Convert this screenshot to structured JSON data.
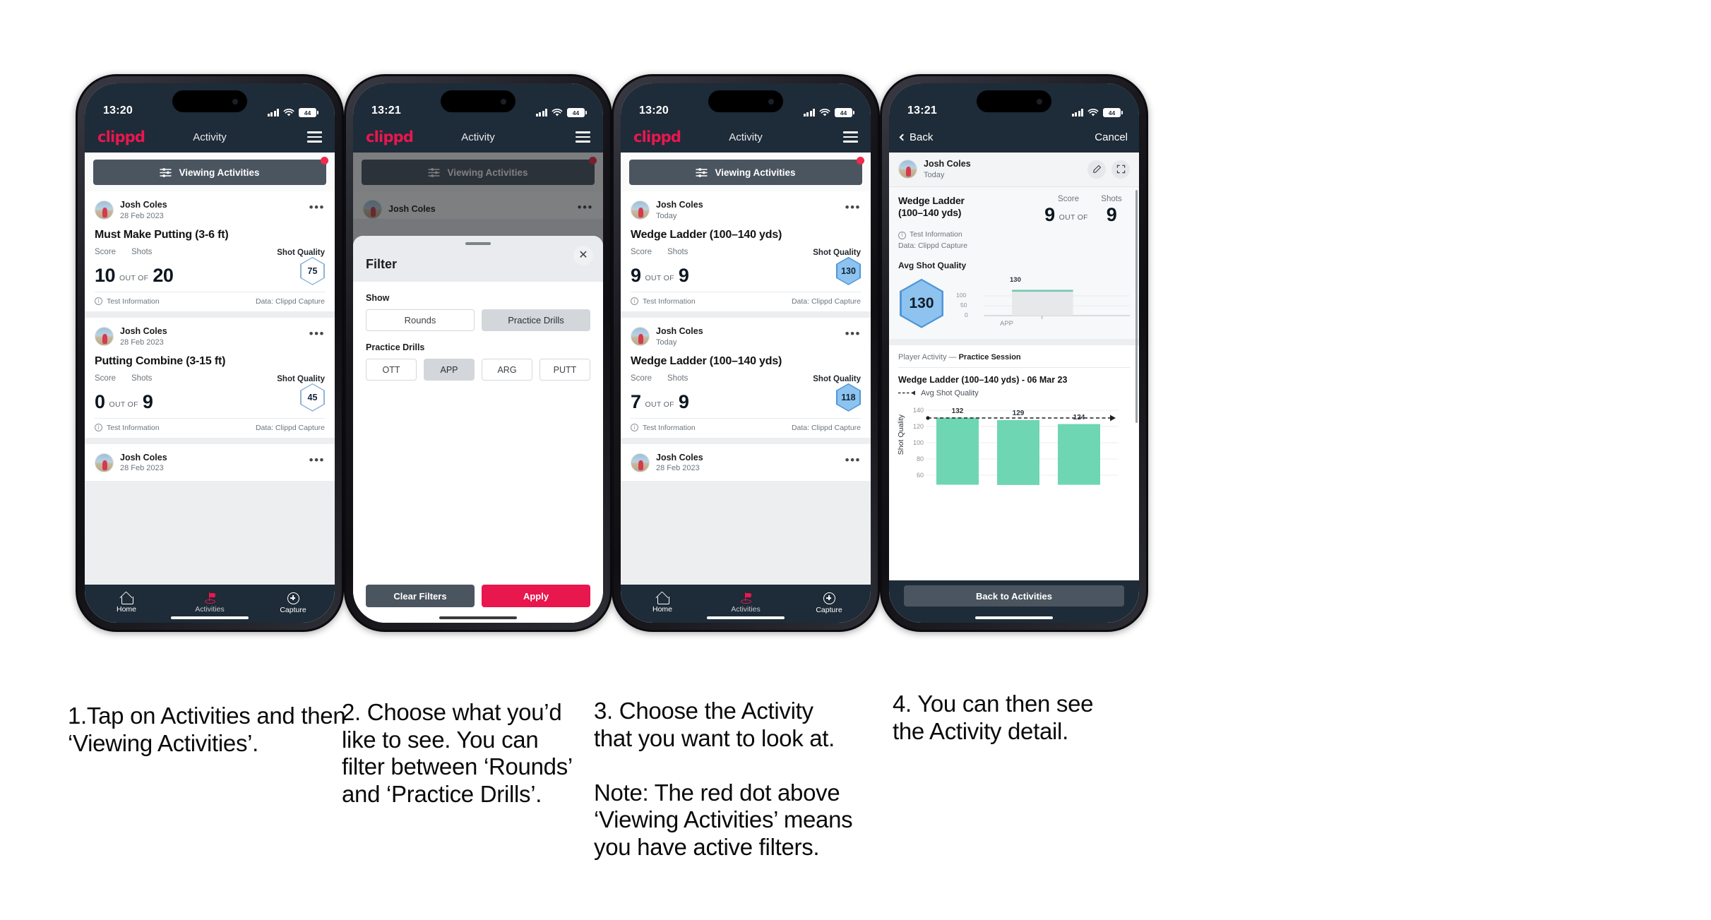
{
  "phones": [
    {
      "status": {
        "clock": "13:20",
        "battery": "44"
      },
      "appbar": {
        "brand": "clippd",
        "title": "Activity",
        "menu_icon": "hamburger-icon"
      },
      "filter_bar": {
        "label": "Viewing Activities",
        "icon": "sliders-icon",
        "has_badge": true
      },
      "cards": [
        {
          "user": "Josh Coles",
          "date": "28 Feb 2023",
          "title": "Must Make Putting (3-6 ft)",
          "score_label": "Score",
          "shots_label": "Shots",
          "quality_label": "Shot Quality",
          "score": "10",
          "outof": "OUT OF",
          "shots": "20",
          "quality": "75",
          "quality_style": "outline",
          "foot_left": "Test Information",
          "foot_right": "Data: Clippd Capture"
        },
        {
          "user": "Josh Coles",
          "date": "28 Feb 2023",
          "title": "Putting Combine (3-15 ft)",
          "score_label": "Score",
          "shots_label": "Shots",
          "quality_label": "Shot Quality",
          "score": "0",
          "outof": "OUT OF",
          "shots": "9",
          "quality": "45",
          "quality_style": "outline",
          "foot_left": "Test Information",
          "foot_right": "Data: Clippd Capture"
        },
        {
          "user": "Josh Coles",
          "date": "28 Feb 2023"
        }
      ],
      "tabs": [
        {
          "label": "Home",
          "icon": "home-icon",
          "active": false
        },
        {
          "label": "Activities",
          "icon": "golf-flag-icon",
          "active": true
        },
        {
          "label": "Capture",
          "icon": "plus-circle-icon",
          "active": false
        }
      ]
    },
    {
      "status": {
        "clock": "13:21",
        "battery": "44"
      },
      "appbar": {
        "brand": "clippd",
        "title": "Activity",
        "menu_icon": "hamburger-icon"
      },
      "filter_bar": {
        "label": "Viewing Activities",
        "icon": "sliders-icon",
        "has_badge": true
      },
      "behind_card_user": "Josh Coles",
      "sheet": {
        "title": "Filter",
        "close_icon": "close-icon",
        "show_label": "Show",
        "show_options": [
          {
            "label": "Rounds",
            "selected": false
          },
          {
            "label": "Practice Drills",
            "selected": true
          }
        ],
        "drills_label": "Practice Drills",
        "drill_options": [
          {
            "label": "OTT",
            "selected": false
          },
          {
            "label": "APP",
            "selected": true
          },
          {
            "label": "ARG",
            "selected": false
          },
          {
            "label": "PUTT",
            "selected": false
          }
        ],
        "clear_label": "Clear Filters",
        "apply_label": "Apply"
      }
    },
    {
      "status": {
        "clock": "13:20",
        "battery": "44"
      },
      "appbar": {
        "brand": "clippd",
        "title": "Activity",
        "menu_icon": "hamburger-icon"
      },
      "filter_bar": {
        "label": "Viewing Activities",
        "icon": "sliders-icon",
        "has_badge": true
      },
      "cards": [
        {
          "user": "Josh Coles",
          "date": "Today",
          "title": "Wedge Ladder (100–140 yds)",
          "score_label": "Score",
          "shots_label": "Shots",
          "quality_label": "Shot Quality",
          "score": "9",
          "outof": "OUT OF",
          "shots": "9",
          "quality": "130",
          "quality_style": "filled",
          "foot_left": "Test Information",
          "foot_right": "Data: Clippd Capture"
        },
        {
          "user": "Josh Coles",
          "date": "Today",
          "title": "Wedge Ladder (100–140 yds)",
          "score_label": "Score",
          "shots_label": "Shots",
          "quality_label": "Shot Quality",
          "score": "7",
          "outof": "OUT OF",
          "shots": "9",
          "quality": "118",
          "quality_style": "filled",
          "foot_left": "Test Information",
          "foot_right": "Data: Clippd Capture"
        },
        {
          "user": "Josh Coles",
          "date": "28 Feb 2023"
        }
      ],
      "tabs": [
        {
          "label": "Home",
          "icon": "home-icon",
          "active": false
        },
        {
          "label": "Activities",
          "icon": "golf-flag-icon",
          "active": true
        },
        {
          "label": "Capture",
          "icon": "plus-circle-icon",
          "active": false
        }
      ]
    },
    {
      "status": {
        "clock": "13:21",
        "battery": "44"
      },
      "navbar": {
        "back": "Back",
        "cancel": "Cancel",
        "back_icon": "chevron-left-icon"
      },
      "detail_head": {
        "user": "Josh Coles",
        "date": "Today",
        "edit_icon": "pencil-icon",
        "expand_icon": "expand-icon"
      },
      "detail": {
        "title": "Wedge Ladder\n(100–140 yds)",
        "score_label": "Score",
        "shots_label": "Shots",
        "score": "9",
        "outof": "OUT OF",
        "shots": "9",
        "meta_left": "Test Information",
        "meta_right": "Data: Clippd Capture",
        "avg_label": "Avg Shot Quality",
        "avg_value": "130",
        "player_activity_prefix": "Player Activity — ",
        "player_activity_value": "Practice Session",
        "chart_title": "Wedge Ladder (100–140 yds) - 06 Mar 23",
        "legend_label": "Avg Shot Quality",
        "back_button": "Back to Activities"
      }
    }
  ],
  "chart_data": [
    {
      "type": "bar",
      "title": "Avg Shot Quality",
      "categories": [
        "APP"
      ],
      "values": [
        130
      ],
      "labels": [
        "130"
      ],
      "ylabel": "",
      "yticks": [
        0,
        50,
        100
      ],
      "ylim": [
        0,
        140
      ],
      "grid": true,
      "legend": "none",
      "bar_color": "#e6e8ea",
      "cap_color": "#74c7ae"
    },
    {
      "type": "bar",
      "title": "Wedge Ladder (100–140 yds) - 06 Mar 23",
      "categories": [
        "",
        "",
        ""
      ],
      "values": [
        132,
        129,
        124
      ],
      "labels": [
        "132",
        "129",
        "124"
      ],
      "xlabel": "",
      "ylabel": "Shot Quality",
      "yticks": [
        60,
        80,
        100,
        120,
        140
      ],
      "ylim": [
        50,
        148
      ],
      "grid": true,
      "legend": "Avg Shot Quality",
      "legend_position": "top-left",
      "bar_color": "#6fd6b4",
      "avg_line": 131,
      "avg_line_style": "dashed"
    }
  ],
  "captions": [
    "1.Tap on Activities and then ‘Viewing Activities’.",
    "2. Choose what you’d like to see. You can filter between ‘Rounds’ and ‘Practice Drills’.",
    "3. Choose the Activity that you want to look at.\n\nNote: The red dot above ‘Viewing Activities’ means you have active filters.",
    "4. You can then see the Activity detail."
  ],
  "colors": {
    "brand_red": "#e8174e",
    "nav_dark": "#1e2b38",
    "filter_grey": "#4b5560",
    "badge_red": "#ef2a4e",
    "hex_blue": "#8dc3ee",
    "bar_green": "#6fd6b4"
  }
}
